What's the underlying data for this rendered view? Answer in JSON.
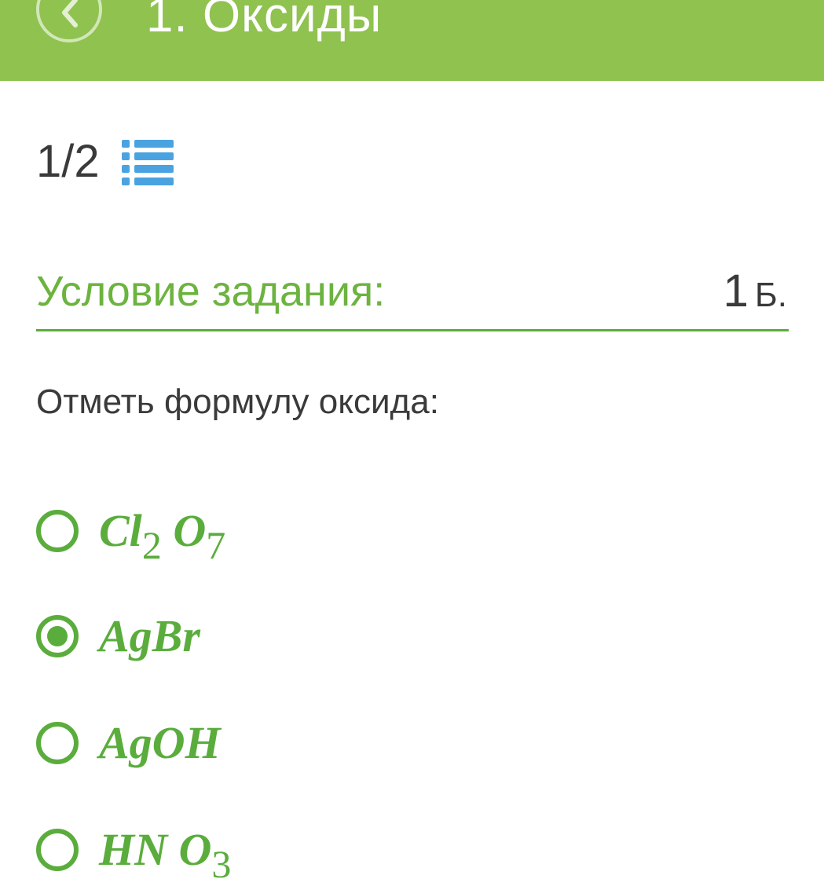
{
  "header": {
    "title": "1. Оксиды",
    "background_color": "#8fc24f",
    "back_icon": "chevron-left-icon"
  },
  "progress": {
    "count": "1/2",
    "list_icon": "list-icon",
    "icon_color": "#4aa3e0"
  },
  "task": {
    "label": "Условие задания:",
    "points_value": "1",
    "points_unit": "Б.",
    "accent_color": "#5aad3c"
  },
  "question": {
    "text": "Отметь формулу оксида:"
  },
  "options": [
    {
      "parts": [
        {
          "t": "Cl"
        },
        {
          "s": "2"
        },
        {
          "t": " O"
        },
        {
          "s": "7"
        }
      ],
      "selected": false
    },
    {
      "parts": [
        {
          "t": "AgBr"
        }
      ],
      "selected": true
    },
    {
      "parts": [
        {
          "t": "AgOH"
        }
      ],
      "selected": false
    },
    {
      "parts": [
        {
          "t": "HN O"
        },
        {
          "s": "3"
        }
      ],
      "selected": false
    }
  ]
}
